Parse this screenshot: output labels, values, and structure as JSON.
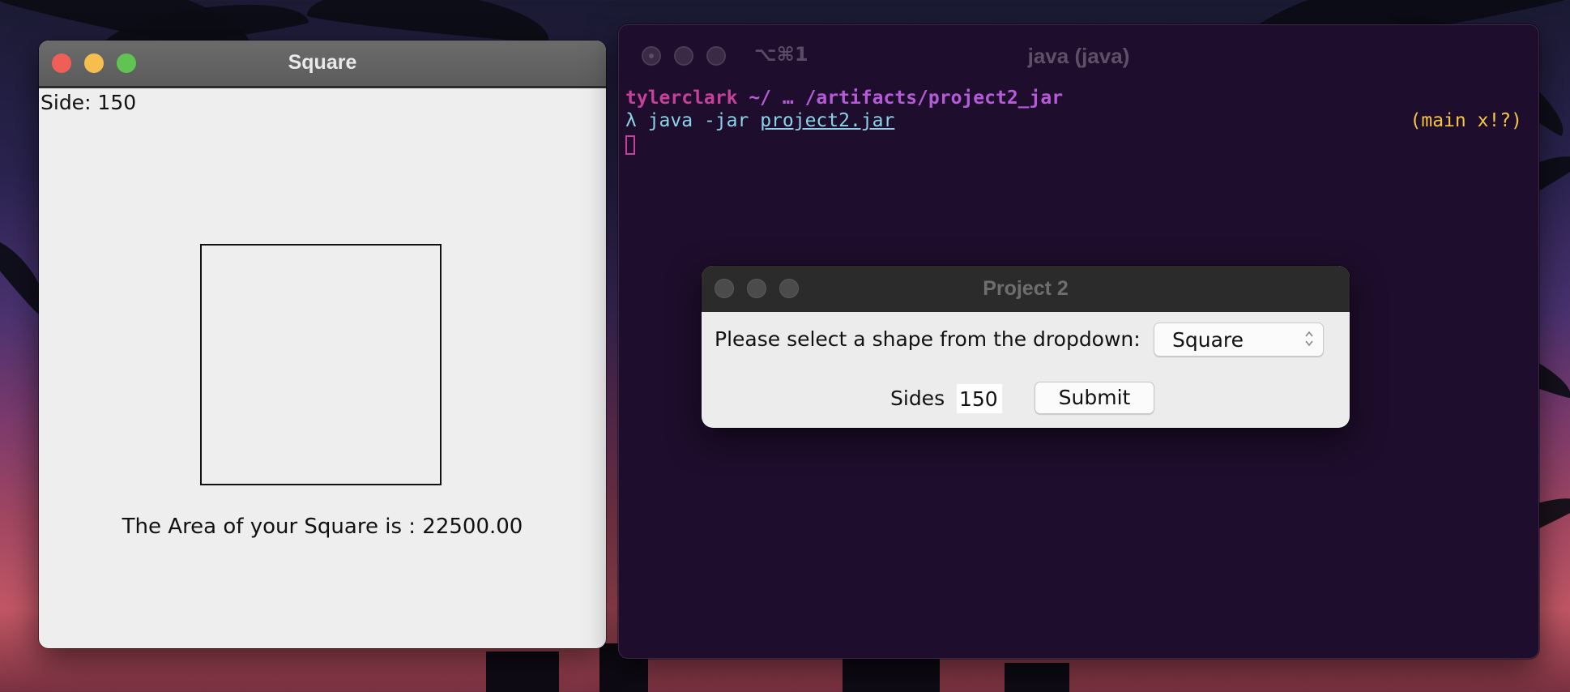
{
  "square_window": {
    "title": "Square",
    "side_label": "Side: 150",
    "area_text": "The Area of your Square is : 22500.00"
  },
  "terminal_window": {
    "title": "java (java)",
    "shortcut": "⌥⌘1",
    "user": "tylerclark",
    "path": " ~/ … /artifacts/project2_jar",
    "prompt_symbol": "λ",
    "command": " java -jar ",
    "command_file": "project2.jar",
    "git_status": "(main x!?)"
  },
  "dialog": {
    "title": "Project 2",
    "select_label": "Please select a shape from the dropdown:",
    "shape_selected": "Square",
    "sides_label": "Sides",
    "sides_value": "150",
    "submit_label": "Submit"
  },
  "colors": {
    "terminal_bg": "#1e0d2c",
    "user": "#c5419a",
    "path": "#b65bd8",
    "prompt": "#8cd3ea",
    "git": "#f4c642",
    "close": "#ee5f57",
    "minimize": "#f6be4f",
    "zoom": "#5fc451"
  },
  "icons": {
    "select_chevron": "up-down-chevron-icon"
  }
}
